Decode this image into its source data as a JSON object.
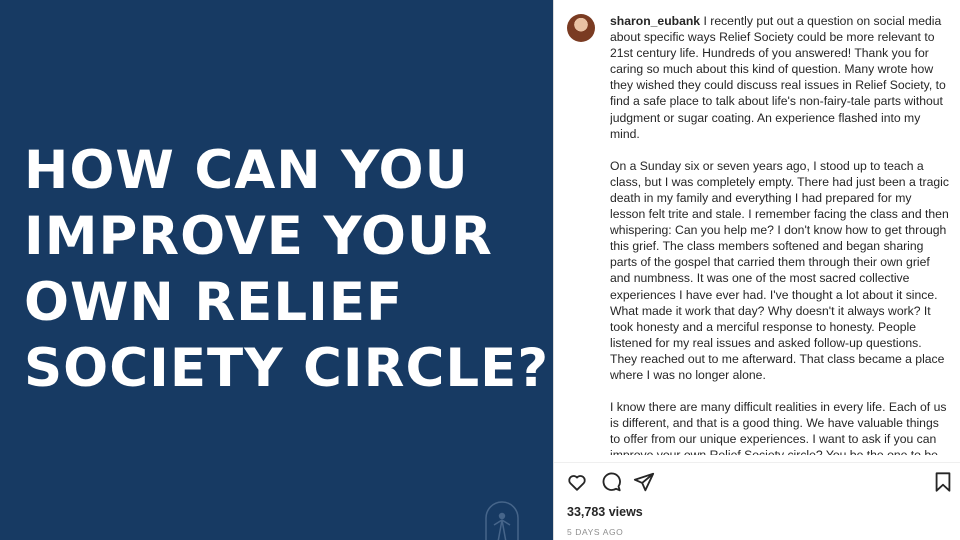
{
  "post": {
    "headline": "HOW CAN YOU\nIMPROVE YOUR\nOWN RELIEF\nSOCIETY CIRCLE?",
    "image_bg": "#173a63"
  },
  "caption": {
    "username": "sharon_eubank",
    "paragraphs": [
      "I recently put out a question on social media about specific ways Relief Society could be more relevant to 21st century life. Hundreds of you answered! Thank you for caring so much about this kind of question. Many wrote how they wished they could discuss real issues in Relief Society, to find a safe place to talk about life's non-fairy-tale parts without judgment or sugar coating. An experience flashed into my mind.",
      "On a Sunday six or seven years ago, I stood up to teach a class, but I was completely empty. There had just been a tragic death in my family and everything I had prepared for my lesson felt trite and stale. I remember facing the class and then whispering: Can you help me? I don't know how to get through this grief. The class members softened and began sharing parts of the gospel that carried them through their own grief and numbness. It was one of the most sacred collective experiences I have ever had. I've thought a lot about it since. What made it work that day? Why doesn't it always work? It took honesty and a merciful response to honesty. People listened for my real issues and asked follow-up questions. They reached out to me afterward. That class became a place where I was no longer alone.",
      "I know there are many difficult realities in every life. Each of us is different, and that is a good thing. We have valuable things to offer from our unique experiences. I want to ask if you can improve your own Relief Society circle? You be the one to be honest. You be the one to offer mercy or kindness. You listen for what's really going on, or follow up afterward. Share your heartfelt feelings about Jesus Christ and His power to heal. It may not be successful at first, but if you keep trying I hope you"
    ]
  },
  "actions": {
    "icons": [
      "heart-icon",
      "comment-icon",
      "share-icon",
      "bookmark-icon"
    ]
  },
  "stats": {
    "views": "33,783 views",
    "time": "5 DAYS AGO"
  }
}
